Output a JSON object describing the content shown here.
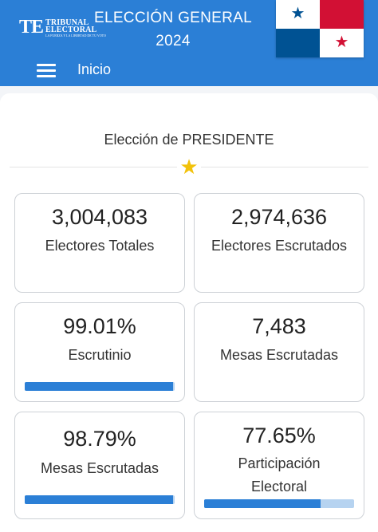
{
  "header": {
    "logo_mark": "TE",
    "logo_line1": "TRIBUNAL",
    "logo_line2": "ELECTORAL",
    "logo_tagline": "LA FUERZA Y LA LIBERTAD DE TU VOTO",
    "title_line1": "ELECCIÓN GENERAL",
    "title_line2": "2024",
    "nav_label": "Inicio"
  },
  "flag": {
    "colors": {
      "red": "#d21034",
      "blue": "#005293",
      "white": "#ffffff"
    }
  },
  "election": {
    "label": "Elección de PRESIDENTE"
  },
  "cards": [
    {
      "value": "3,004,083",
      "label": "Electores Totales"
    },
    {
      "value": "2,974,636",
      "label": "Electores Escrutados"
    },
    {
      "value": "99.01%",
      "label": "Escrutinio",
      "progress": 99.01
    },
    {
      "value": "7,483",
      "label": "Mesas Escrutadas"
    },
    {
      "value": "98.79%",
      "label": "Mesas Escrutadas",
      "progress": 98.79
    },
    {
      "value": "77.65%",
      "label_line1": "Participación",
      "label_line2": "Electoral",
      "progress": 77.65
    }
  ],
  "colors": {
    "brand": "#2b7fd6",
    "bar_track": "#b6d3f0",
    "star": "#f2c20b"
  }
}
